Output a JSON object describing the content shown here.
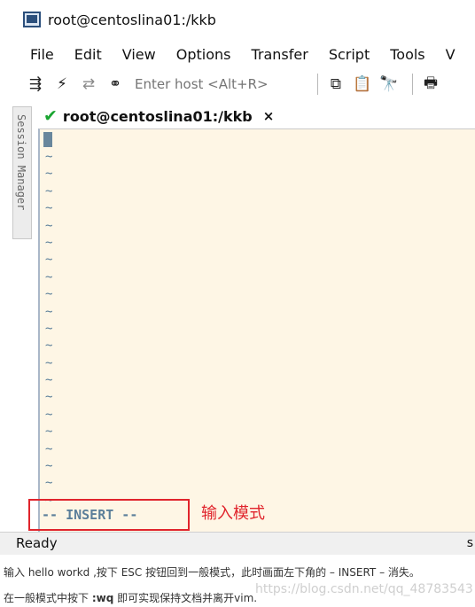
{
  "window": {
    "title": "root@centoslina01:/kkb"
  },
  "menu": [
    "File",
    "Edit",
    "View",
    "Options",
    "Transfer",
    "Script",
    "Tools",
    "V"
  ],
  "toolbar": {
    "host_placeholder": "Enter host <Alt+R>"
  },
  "side_panel": {
    "label": "Session Manager"
  },
  "session_tab": {
    "label": "root@centoslina01:/kkb",
    "close": "×"
  },
  "terminal": {
    "tilde": "~",
    "tilde_count": 21,
    "mode_line": "-- INSERT --",
    "background": "#fef6e5",
    "text_color": "#5b7f9a"
  },
  "annotation": {
    "text": "输入模式",
    "color": "#e0242c"
  },
  "status": {
    "text": "Ready",
    "right": "s"
  },
  "captions": {
    "line1": "输入 hello workd ,按下 ESC 按钮回到一般模式，此时画面左下角的 – INSERT – 消失。",
    "line2_prefix": "在一般模式中按下 ",
    "line2_cmd": ":wq",
    "line2_suffix": " 即可实现保持文档并离开vim."
  },
  "watermark": "https://blog.csdn.net/qq_48783543"
}
